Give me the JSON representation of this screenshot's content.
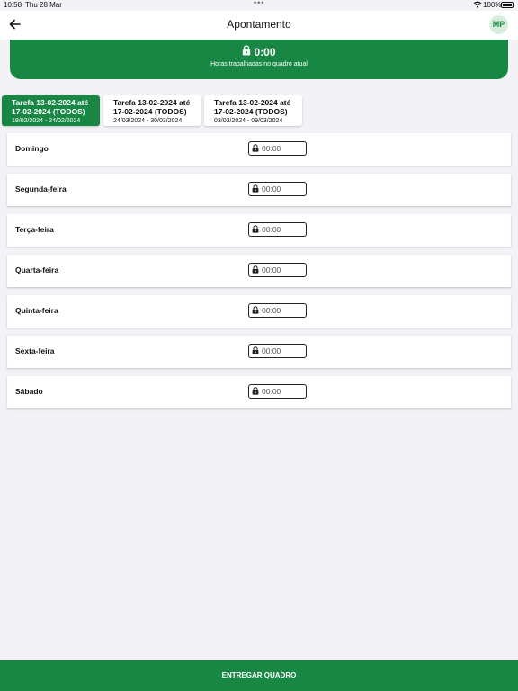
{
  "status_bar": {
    "time": "10:58",
    "date": "Thu 28 Mar",
    "battery": "100%"
  },
  "header": {
    "title": "Apontamento",
    "avatar_initials": "MP"
  },
  "summary": {
    "value": "0:00",
    "label": "Horas trabalhadas no quadro atual"
  },
  "tabs": [
    {
      "title_line1": "Tarefa 13-02-2024 até",
      "title_line2": "17-02-2024 (TODOS)",
      "range": "18/02/2024 - 24/02/2024",
      "active": true
    },
    {
      "title_line1": "Tarefa 13-02-2024 até",
      "title_line2": "17-02-2024 (TODOS)",
      "range": "24/03/2024 - 30/03/2024",
      "active": false
    },
    {
      "title_line1": "Tarefa 13-02-2024 até",
      "title_line2": "17-02-2024 (TODOS)",
      "range": "03/03/2024 - 09/03/2024",
      "active": false
    }
  ],
  "days": [
    {
      "label": "Domingo",
      "value": "00:00"
    },
    {
      "label": "Segunda-feira",
      "value": "00:00"
    },
    {
      "label": "Terça-feira",
      "value": "00:00"
    },
    {
      "label": "Quarta-feira",
      "value": "00:00"
    },
    {
      "label": "Quinta-feira",
      "value": "00:00"
    },
    {
      "label": "Sexta-feira",
      "value": "00:00"
    },
    {
      "label": "Sábado",
      "value": "00:00"
    }
  ],
  "footer": {
    "button_label": "ENTREGAR QUADRO"
  },
  "colors": {
    "accent": "#198744",
    "background": "#f2f2f7"
  }
}
